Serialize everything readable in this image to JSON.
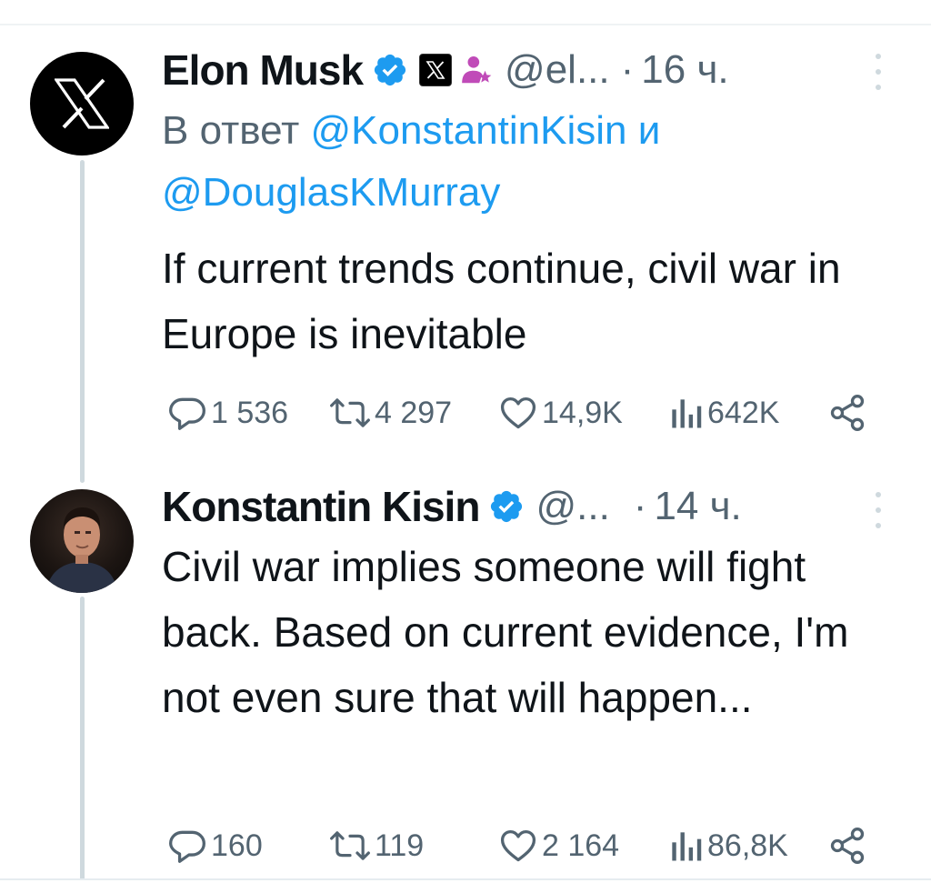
{
  "tweets": [
    {
      "author_name": "Elon Musk",
      "handle": "@el...",
      "separator": "·",
      "time": "16 ч.",
      "reply_prefix": "В ответ",
      "reply_mention_1": "@KonstantinKisin",
      "reply_conjunction": "и",
      "reply_mention_2": "@DouglasKMurray",
      "text": "If current trends continue, civil war in Europe is inevitable",
      "stats": {
        "replies": "1 536",
        "reposts": "4 297",
        "likes": "14,9K",
        "views": "642K"
      },
      "avatar_icon": "x-logo-icon",
      "badges": [
        "verified-badge-icon",
        "x-affiliation-badge-icon",
        "role-person-icon"
      ]
    },
    {
      "author_name": "Konstantin Kisin",
      "handle": "@...",
      "separator": "·",
      "time": "14 ч.",
      "text": "Civil war implies someone will fight back. Based on current evidence, I'm not even sure that will happen...",
      "stats": {
        "replies": "160",
        "reposts": "119",
        "likes": "2 164",
        "views": "86,8K"
      },
      "avatar_icon": "profile-photo",
      "badges": [
        "verified-badge-icon"
      ]
    }
  ],
  "colors": {
    "text": "#0f1419",
    "secondary": "#536471",
    "link": "#1d9bf0",
    "verified": "#1d9bf0",
    "thread_line": "#cfd9de"
  }
}
